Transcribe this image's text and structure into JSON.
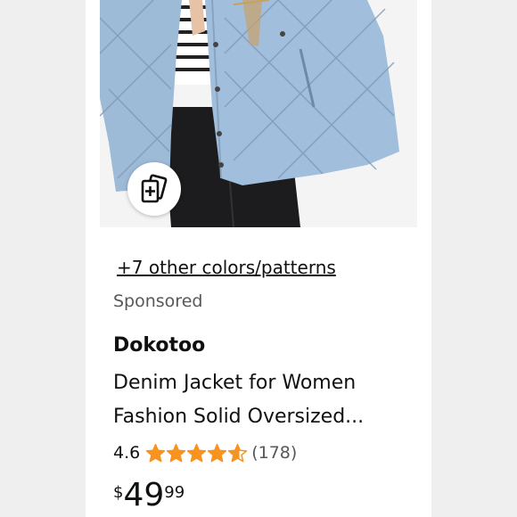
{
  "product": {
    "colors_link": "+7 other colors/patterns",
    "sponsored_label": "Sponsored",
    "brand": "Dokotoo",
    "title_line1": "Denim Jacket for Women",
    "title_line2": "Fashion Solid Oversized...",
    "rating": "4.6",
    "rating_stars_value": 4.6,
    "rating_stars_max": 5,
    "review_count": "(178)",
    "price_symbol": "$",
    "price_whole": "49",
    "price_fraction": "99"
  },
  "icons": {
    "similar_items": "view-similar-icon",
    "star": "star-icon"
  },
  "colors": {
    "star": "#f7931e",
    "text": "#0f1111",
    "secondary_text": "#565959",
    "denim": "#9dbad6"
  }
}
